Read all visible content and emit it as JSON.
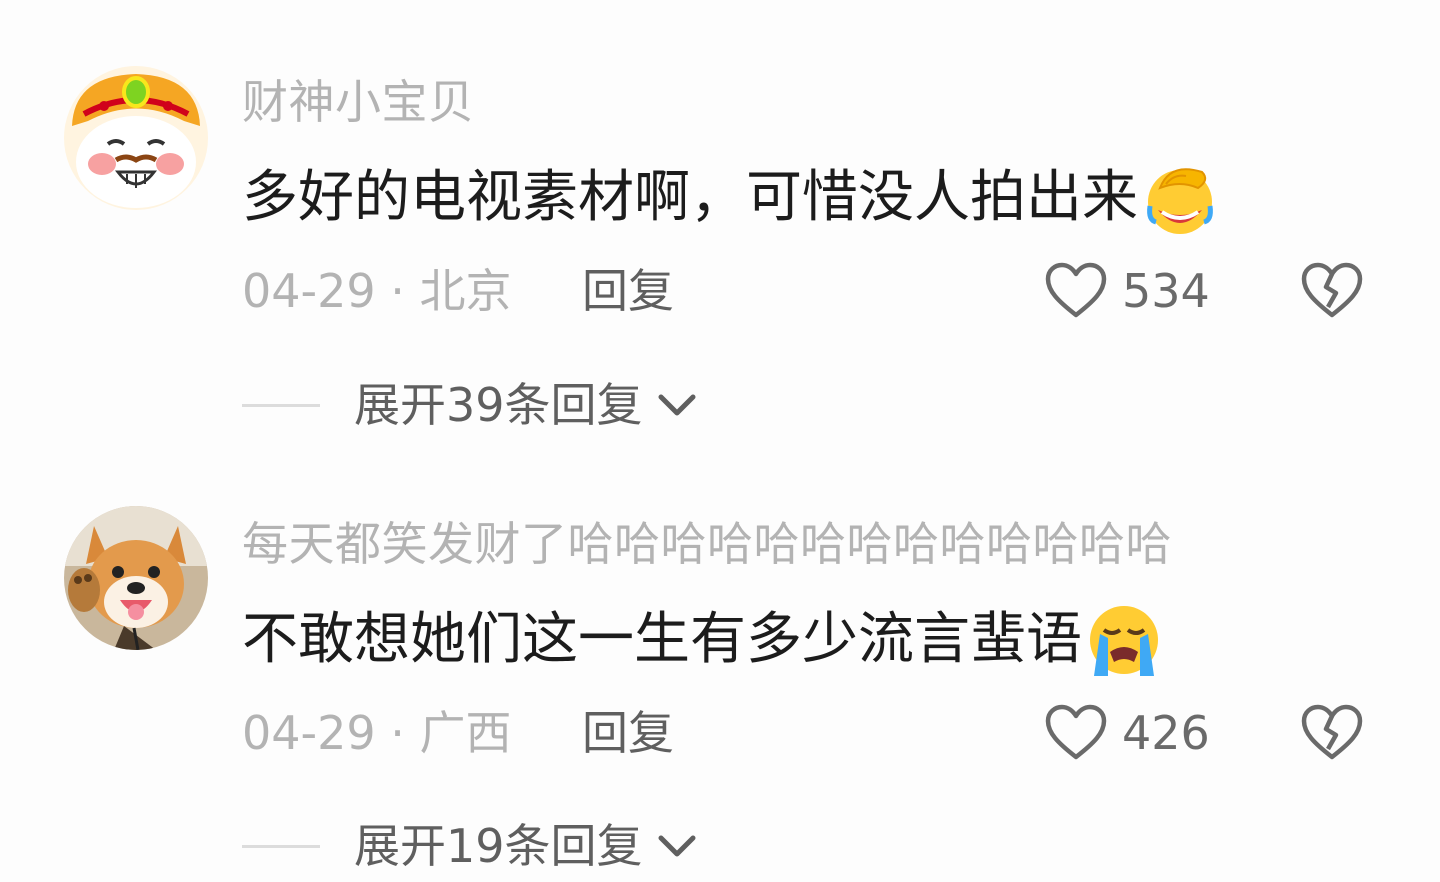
{
  "comments": [
    {
      "username": "财神小宝贝",
      "text": "多好的电视素材啊，可惜没人拍出来",
      "emoji": "face-palm-laughing-emoji",
      "date_location": "04-29 · 北京",
      "reply_label": "回复",
      "like_count": "534",
      "expand_label": "展开39条回复"
    },
    {
      "username": "每天都笑发财了哈哈哈哈哈哈哈哈哈哈哈哈哈",
      "text": "不敢想她们这一生有多少流言蜚语",
      "emoji": "loudly-crying-emoji",
      "date_location": "04-29 · 广西",
      "reply_label": "回复",
      "like_count": "426",
      "expand_label": "展开19条回复"
    }
  ],
  "colors": {
    "background": "#fdfdfd",
    "username": "#b3b3b3",
    "content": "#1c1c1c",
    "action": "#5f5f5f"
  }
}
